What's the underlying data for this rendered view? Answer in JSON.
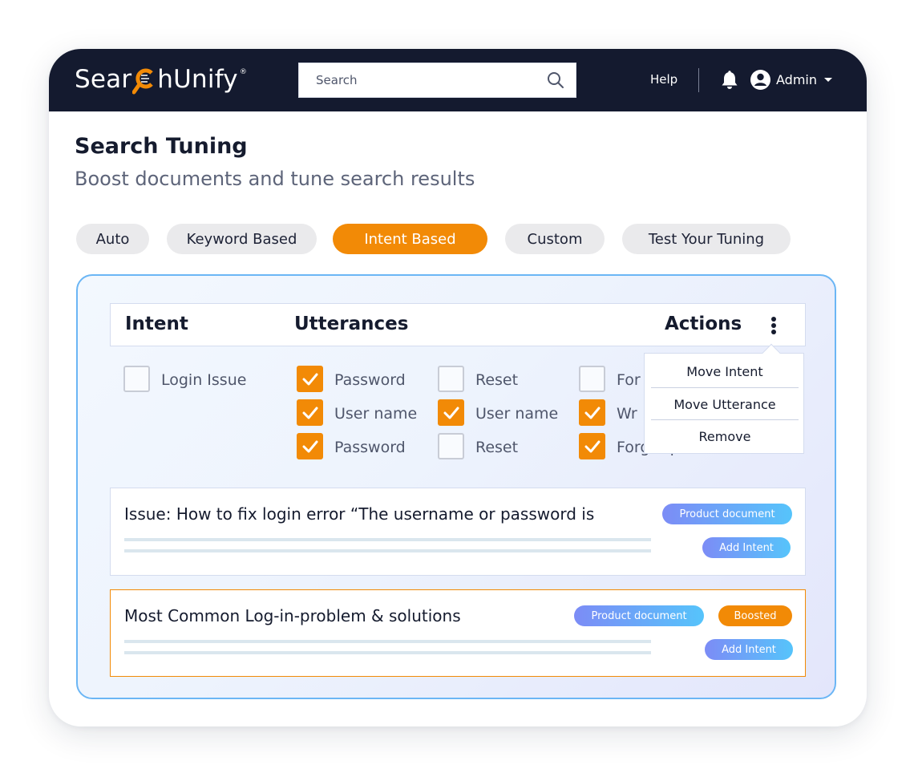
{
  "header": {
    "logo_text_before": "Sear",
    "logo_text_after": "hUnify",
    "logo_mark": "®",
    "search_placeholder": "Search",
    "search_icon": "search-icon",
    "help_label": "Help",
    "notification_icon": "bell-icon",
    "user_icon": "user-circle-icon",
    "user_label": "Admin",
    "colors": {
      "background": "#141a2f",
      "accent": "#f28a06"
    }
  },
  "page": {
    "title": "Search Tuning",
    "subtitle": "Boost documents and tune search results"
  },
  "tabs": [
    {
      "label": "Auto",
      "active": false
    },
    {
      "label": "Keyword Based",
      "active": false
    },
    {
      "label": "Intent Based",
      "active": true
    },
    {
      "label": "Custom",
      "active": false
    },
    {
      "label": "Test Your Tuning",
      "active": false
    }
  ],
  "table": {
    "headers": {
      "intent": "Intent",
      "utterances": "Utterances",
      "actions": "Actions"
    },
    "intent": {
      "label": "Login Issue",
      "checked": false
    },
    "utterances": [
      {
        "label": "Password",
        "checked": true
      },
      {
        "label": "Reset",
        "checked": false
      },
      {
        "label": "For",
        "checked": false
      },
      {
        "label": "User name",
        "checked": true
      },
      {
        "label": "User name",
        "checked": true
      },
      {
        "label": "Wr",
        "checked": true
      },
      {
        "label": "Password",
        "checked": true
      },
      {
        "label": "Reset",
        "checked": false
      },
      {
        "label": "Forget password",
        "checked": true
      }
    ]
  },
  "actions_menu": {
    "items": [
      "Move Intent",
      "Move Utterance",
      "Remove"
    ]
  },
  "results": [
    {
      "title": "Issue: How to fix login error “The username or password is",
      "tags": [
        "Product document"
      ],
      "action": "Add Intent",
      "boosted": false
    },
    {
      "title": "Most Common Log-in-problem & solutions",
      "tags": [
        "Product document",
        "Boosted"
      ],
      "action": "Add Intent",
      "boosted": true
    }
  ]
}
